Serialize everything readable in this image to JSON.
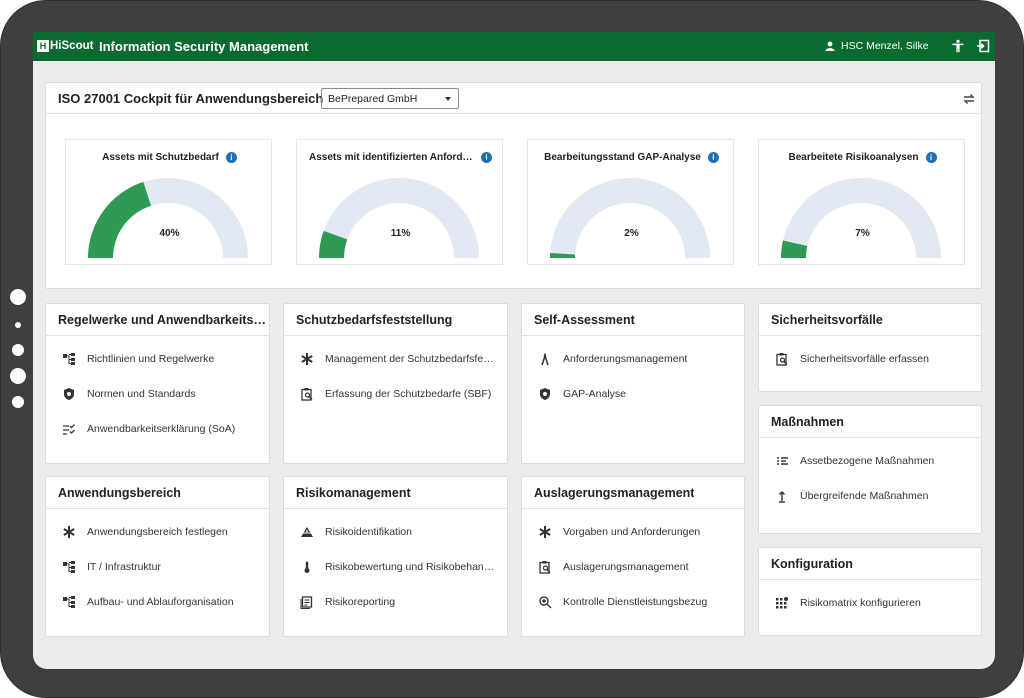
{
  "app": {
    "logo": "HiScout",
    "title": "Information Security Management",
    "user": "HSC Menzel, Silke"
  },
  "cockpit": {
    "title": "ISO 27001 Cockpit für Anwendungsbereich",
    "select_value": "BePrepared GmbH"
  },
  "colors": {
    "accent": "#0b6a2f",
    "gauge_fill": "#2e9a55",
    "gauge_track": "#e3e9f3",
    "info": "#1f6fb5"
  },
  "gauges": [
    {
      "title": "Assets mit Schutzbedarf",
      "value_label": "40%",
      "percent": 0.4
    },
    {
      "title": "Assets mit identifizierten Anforderungen",
      "value_label": "11%",
      "percent": 0.11
    },
    {
      "title": "Bearbeitungsstand GAP-Analyse",
      "value_label": "2%",
      "percent": 0.02
    },
    {
      "title": "Bearbeitete Risikoanalysen",
      "value_label": "7%",
      "percent": 0.07
    }
  ],
  "tiles": [
    {
      "title": "Regelwerke und Anwendbarkeitserklärung",
      "items": [
        {
          "label": "Richtlinien und Regelwerke",
          "icon": "hierarchy-icon"
        },
        {
          "label": "Normen und Standards",
          "icon": "shield-icon"
        },
        {
          "label": "Anwendbarkeitserklärung (SoA)",
          "icon": "checklist-icon"
        }
      ]
    },
    {
      "title": "Schutzbedarfsfeststellung",
      "items": [
        {
          "label": "Management der Schutzbedarfsfeststellung",
          "icon": "asterisk-icon"
        },
        {
          "label": "Erfassung der Schutzbedarfe (SBF)",
          "icon": "clipboard-search-icon"
        }
      ]
    },
    {
      "title": "Self-Assessment",
      "items": [
        {
          "label": "Anforderungsmanagement",
          "icon": "compass-icon"
        },
        {
          "label": "GAP-Analyse",
          "icon": "shield-icon"
        }
      ]
    },
    {
      "title": "Sicherheitsvorfälle",
      "items": [
        {
          "label": "Sicherheitsvorfälle erfassen",
          "icon": "clipboard-search-icon"
        }
      ]
    },
    {
      "title": "Maßnahmen",
      "items": [
        {
          "label": "Assetbezogene Maßnahmen",
          "icon": "list-bullet-icon"
        },
        {
          "label": "Übergreifende Maßnahmen",
          "icon": "upload-icon"
        }
      ]
    },
    {
      "title": "Anwendungsbereich",
      "items": [
        {
          "label": "Anwendungsbereich festlegen",
          "icon": "asterisk-icon"
        },
        {
          "label": "IT / Infrastruktur",
          "icon": "hierarchy-icon"
        },
        {
          "label": "Aufbau- und Ablauforganisation",
          "icon": "hierarchy-icon"
        }
      ]
    },
    {
      "title": "Risikomanagement",
      "items": [
        {
          "label": "Risikoidentifikation",
          "icon": "hazard-icon"
        },
        {
          "label": "Risikobewertung und Risikobehandlung",
          "icon": "thermometer-icon"
        },
        {
          "label": "Risikoreporting",
          "icon": "report-icon"
        }
      ]
    },
    {
      "title": "Auslagerungsmanagement",
      "items": [
        {
          "label": "Vorgaben und Anforderungen",
          "icon": "asterisk-icon"
        },
        {
          "label": "Auslagerungsmanagement",
          "icon": "clipboard-search-icon"
        },
        {
          "label": "Kontrolle Dienstleistungsbezug",
          "icon": "zoom-icon"
        }
      ]
    },
    {
      "title": "Konfiguration",
      "items": [
        {
          "label": "Risikomatrix konfigurieren",
          "icon": "matrix-icon"
        }
      ]
    }
  ]
}
